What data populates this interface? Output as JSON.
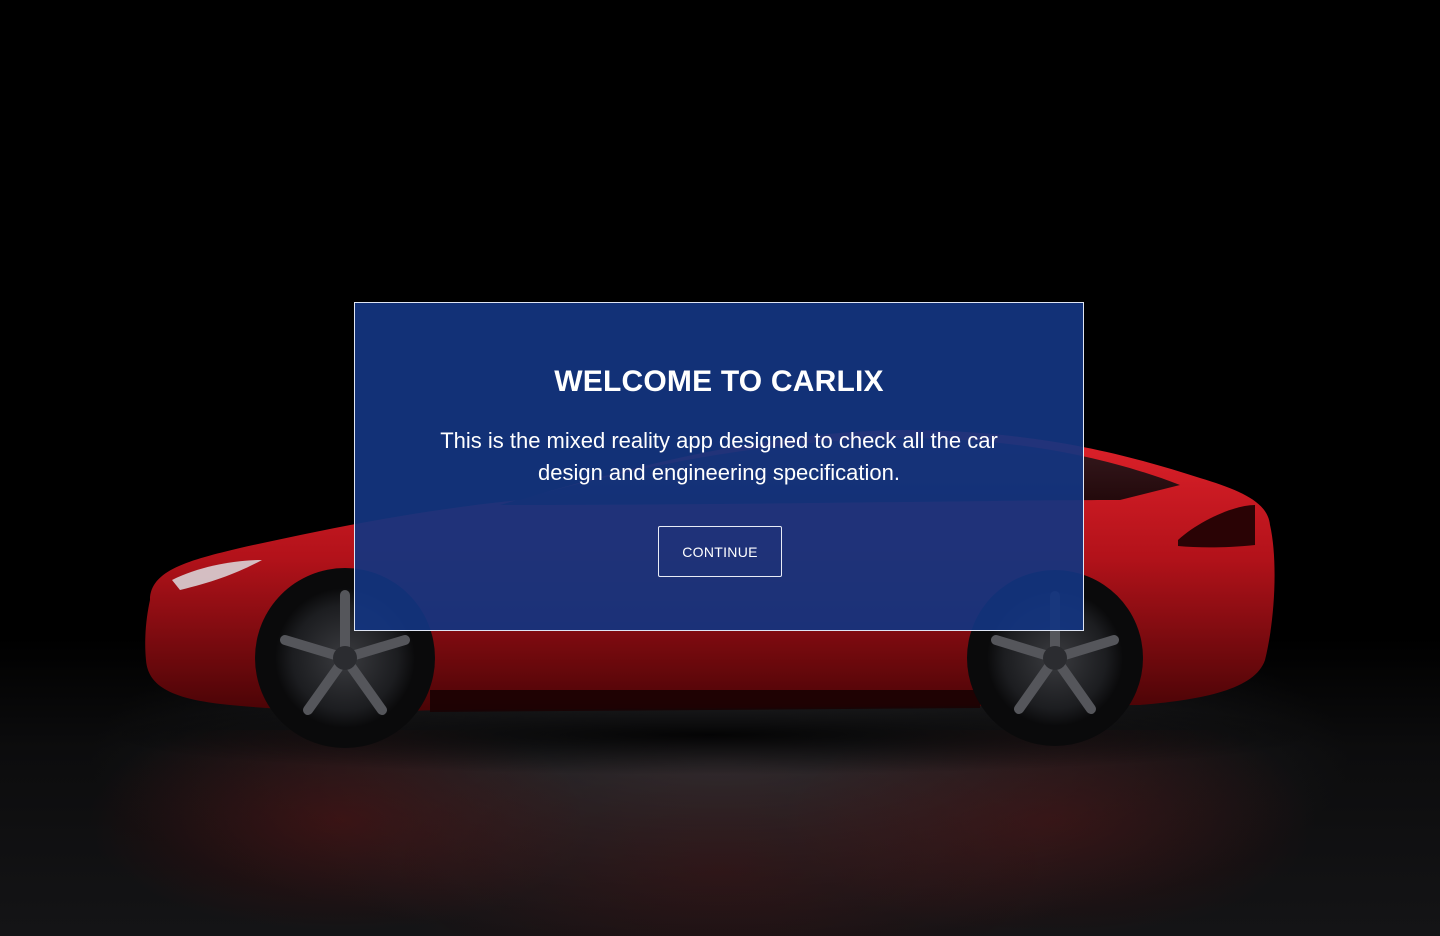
{
  "dialog": {
    "title": "WELCOME TO CARLIX",
    "description": "This is the mixed reality app designed to check all the car design and engineering specification.",
    "continue_label": "CONTINUE"
  },
  "colors": {
    "dialog_background": "#133580",
    "dialog_border": "#dfe5f3",
    "text": "#ffffff",
    "car_body": "#b3121a",
    "page_background": "#000000"
  }
}
